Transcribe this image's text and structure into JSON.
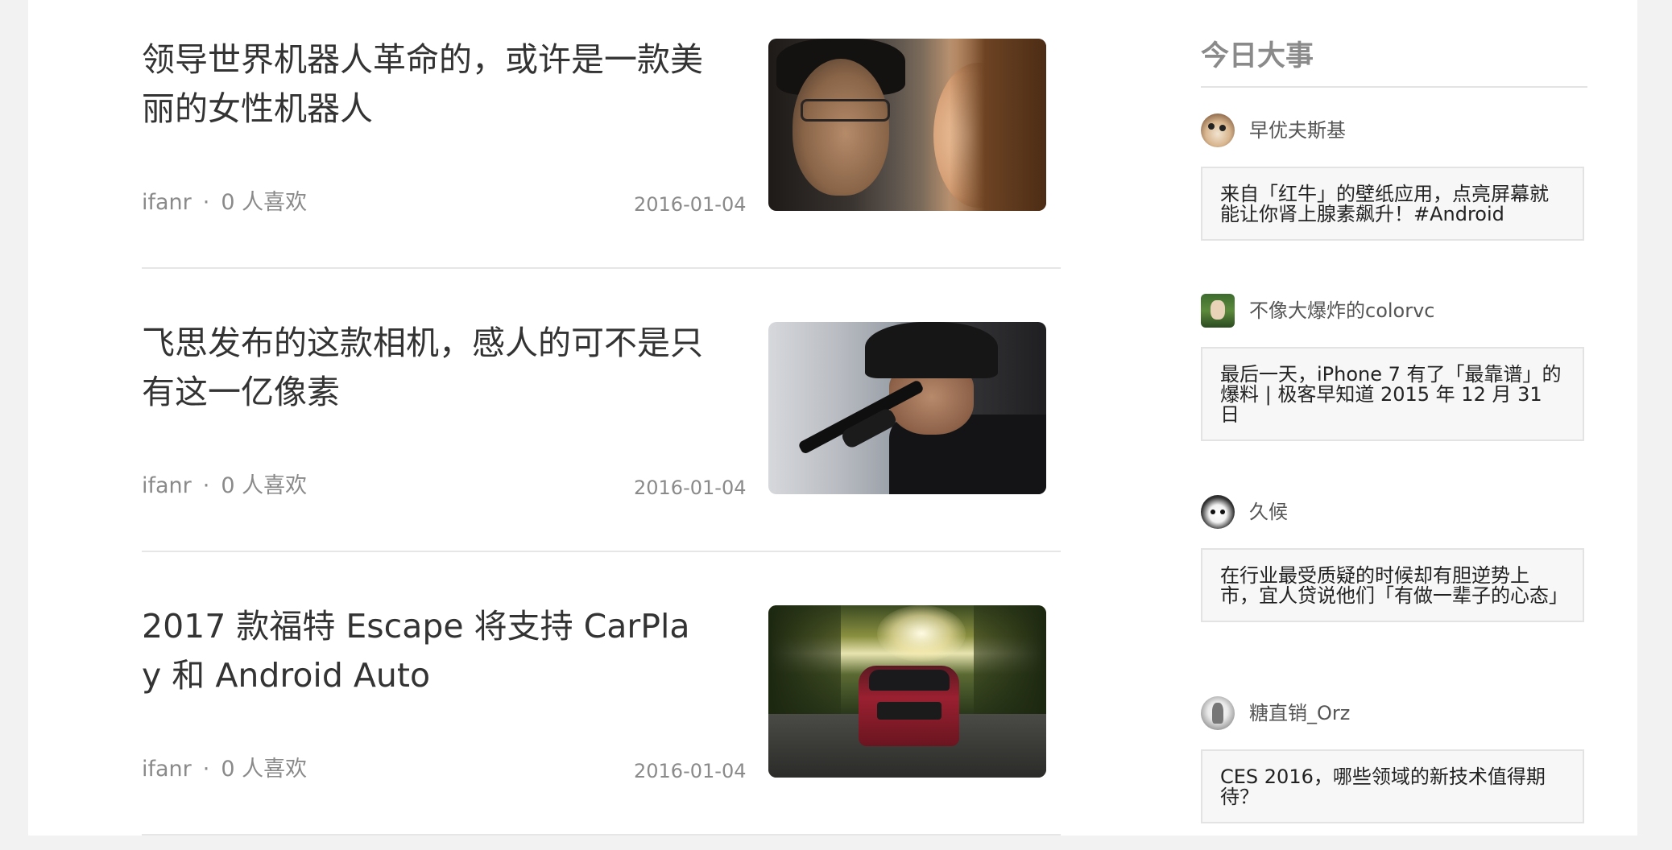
{
  "articles": [
    {
      "title": "领导世界机器人革命的，或许是一款美丽的女性机器人",
      "author": "ifanr",
      "separator": "·",
      "likes": "0 人喜欢",
      "date": "2016-01-04",
      "thumb_icon": "robot-photo"
    },
    {
      "title": "飞思发布的这款相机，感人的可不是只有这一亿像素",
      "author": "ifanr",
      "separator": "·",
      "likes": "0 人喜欢",
      "date": "2016-01-04",
      "thumb_icon": "sniper-photo"
    },
    {
      "title": "2017 款福特 Escape 将支持 CarPlay 和 Android Auto",
      "author": "ifanr",
      "separator": "·",
      "likes": "0 人喜欢",
      "date": "2016-01-04",
      "thumb_icon": "car-photo"
    }
  ],
  "sidebar": {
    "title": "今日大事",
    "items": [
      {
        "username": "早优夫斯基",
        "text": "来自「红牛」的壁纸应用，点亮屏幕就能让你肾上腺素飙升！#Android",
        "avatar_icon": "dog-avatar"
      },
      {
        "username": "不像大爆炸的colorvc",
        "text": "最后一天，iPhone 7 有了「最靠谱」的爆料 | 极客早知道 2015 年 12 月 31 日",
        "avatar_icon": "portrait-avatar"
      },
      {
        "username": "久候",
        "text": "在行业最受质疑的时候却有胆逆势上市，宜人贷说他们「有做一辈子的心态」",
        "avatar_icon": "anime-avatar"
      },
      {
        "username": "糖直销_Orz",
        "text": "CES 2016，哪些领域的新技术值得期待？",
        "avatar_icon": "figure-avatar"
      }
    ]
  }
}
